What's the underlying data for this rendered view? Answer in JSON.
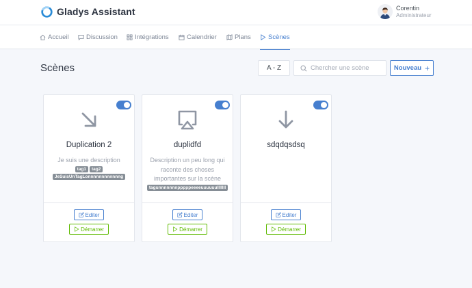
{
  "app": {
    "title": "Gladys Assistant",
    "user_name": "Corentin",
    "user_role": "Administrateur"
  },
  "nav": {
    "items": [
      {
        "label": "Accueil",
        "icon": "home-icon"
      },
      {
        "label": "Discussion",
        "icon": "message-icon"
      },
      {
        "label": "Intégrations",
        "icon": "grid-icon"
      },
      {
        "label": "Calendrier",
        "icon": "calendar-icon"
      },
      {
        "label": "Plans",
        "icon": "map-icon"
      },
      {
        "label": "Scènes",
        "icon": "play-icon",
        "active": true
      }
    ]
  },
  "page": {
    "title": "Scènes",
    "sort_label": "A - Z",
    "search_placeholder": "Chercher une scène",
    "new_label": "Nouveau"
  },
  "scenes": [
    {
      "title": "Duplication 2",
      "description": "Je suis une description",
      "icon": "arrow-down-right-icon",
      "enabled": true,
      "tags": [
        "tag1",
        "tag2",
        "JeSuisUnTagLonnnnnnnnnnnng"
      ]
    },
    {
      "title": "duplidfd",
      "description": "Description un peu long qui raconte des choses importantes sur la scène",
      "icon": "airplay-icon",
      "enabled": true,
      "tags": [
        "tagunnnnnnnpppppeeeeuuuuuulllllll"
      ]
    },
    {
      "title": "sdqdqsdsq",
      "description": "",
      "icon": "arrow-down-icon",
      "enabled": true,
      "tags": []
    }
  ],
  "buttons": {
    "edit_label": "Editer",
    "start_label": "Démarrer"
  },
  "colors": {
    "primary": "#467fcf",
    "success": "#5eba00",
    "tag": "#868e96",
    "background": "#f5f7fb"
  }
}
